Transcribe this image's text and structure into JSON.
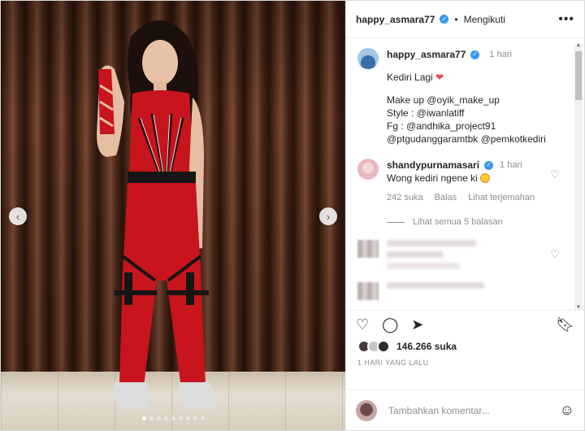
{
  "header": {
    "username": "happy_asmara77",
    "separator": "•",
    "follow_label": "Mengikuti",
    "more_icon": "more-dots-icon"
  },
  "caption": {
    "username": "happy_asmara77",
    "time": "1 hari",
    "line1": "Kediri Lagi",
    "line1_emoji": "❤",
    "line2": "Make up @oyik_make_up",
    "line3": "Style : @iwanlatiff",
    "line4": "Fg : @andhika_project91",
    "line5": "@ptgudanggaramtbk @pemkotkediri"
  },
  "comments": [
    {
      "username": "shandypurnamasari",
      "time": "1 hari",
      "text": "Wong kediri ngene ki",
      "likes": "242 suka",
      "reply_label": "Balas",
      "translate_label": "Lihat terjemahan",
      "view_replies": "Lihat semua 5 balasan"
    }
  ],
  "likes": {
    "count": "146.266 suka"
  },
  "date": "1 HARI YANG LALU",
  "add_comment": {
    "placeholder": "Tambahkan komentar..."
  },
  "carousel": {
    "dot_count": 9,
    "active_dot": 0
  },
  "colors": {
    "verified": "#3897f0",
    "outfit": "#c8141c",
    "muted_text": "#8e8e8e"
  }
}
